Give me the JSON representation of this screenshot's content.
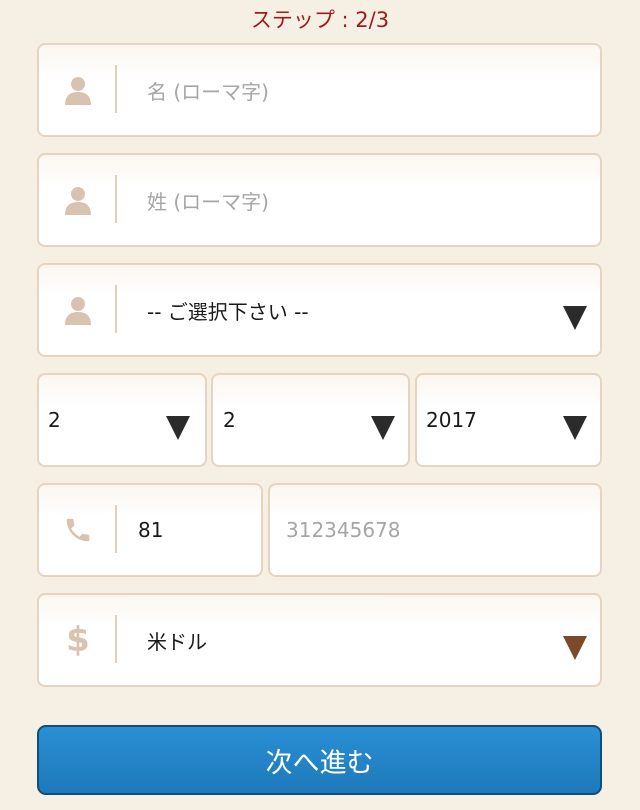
{
  "step": {
    "label": "ステップ : 2/3"
  },
  "form": {
    "first_name": {
      "placeholder": "名 (ローマ字)",
      "value": ""
    },
    "last_name": {
      "placeholder": "姓 (ローマ字)",
      "value": ""
    },
    "title_select": {
      "selected": "-- ご選択下さい --"
    },
    "birth": {
      "day": "2",
      "month": "2",
      "year": "2017"
    },
    "phone": {
      "country_code": "81",
      "number_placeholder": "312345678",
      "number_value": ""
    },
    "currency": {
      "selected": "米ドル"
    },
    "submit_label": "次へ進む"
  },
  "icons": {
    "person": "person-icon",
    "phone": "phone-icon",
    "dollar": "dollar-icon",
    "dollar_glyph": "$",
    "dropdown": "triangle-down-icon"
  },
  "colors": {
    "background": "#f6efe4",
    "step_text": "#9b1c1c",
    "field_border": "#e5d4bf",
    "icon": "#d8c3b0",
    "button": "#1d79ba",
    "button_border": "#0d4f78",
    "currency_arrow": "#7a4a2b"
  }
}
